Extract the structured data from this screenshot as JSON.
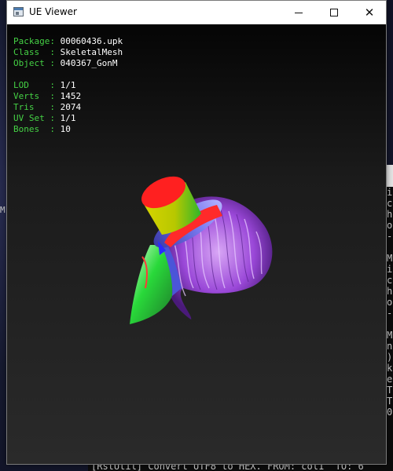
{
  "window": {
    "title": "UE Viewer",
    "icon": "app-window-icon"
  },
  "info": {
    "package_label": "Package",
    "package_value": "00060436.upk",
    "class_label": "Class  ",
    "class_value": "SkeletalMesh",
    "object_label": "Object ",
    "object_value": "040367_GonM",
    "lod_label": "LOD    ",
    "lod_value": "1/1",
    "verts_label": "Verts  ",
    "verts_value": "1452",
    "tris_label": "Tris   ",
    "tris_value": "2074",
    "uvset_label": "UV Set ",
    "uvset_value": "1/1",
    "bones_label": "Bones  ",
    "bones_value": "10"
  },
  "colors": {
    "label": "#45d145",
    "value": "#ffffff",
    "viewport_top": "#050505",
    "viewport_bottom": "#2a2a2a"
  },
  "background": {
    "left_fragment": "M",
    "console_lines": [
      "i",
      "c",
      "h",
      "o",
      "-",
      "",
      "M",
      "i",
      "c",
      "h",
      "o",
      "-",
      "",
      "M",
      "n",
      ")",
      "k",
      "e",
      "T",
      "T",
      "0"
    ],
    "console_bottom": "[RstUtil] Convert UTF8 to HEX. FROM: col1  TO: 6"
  }
}
